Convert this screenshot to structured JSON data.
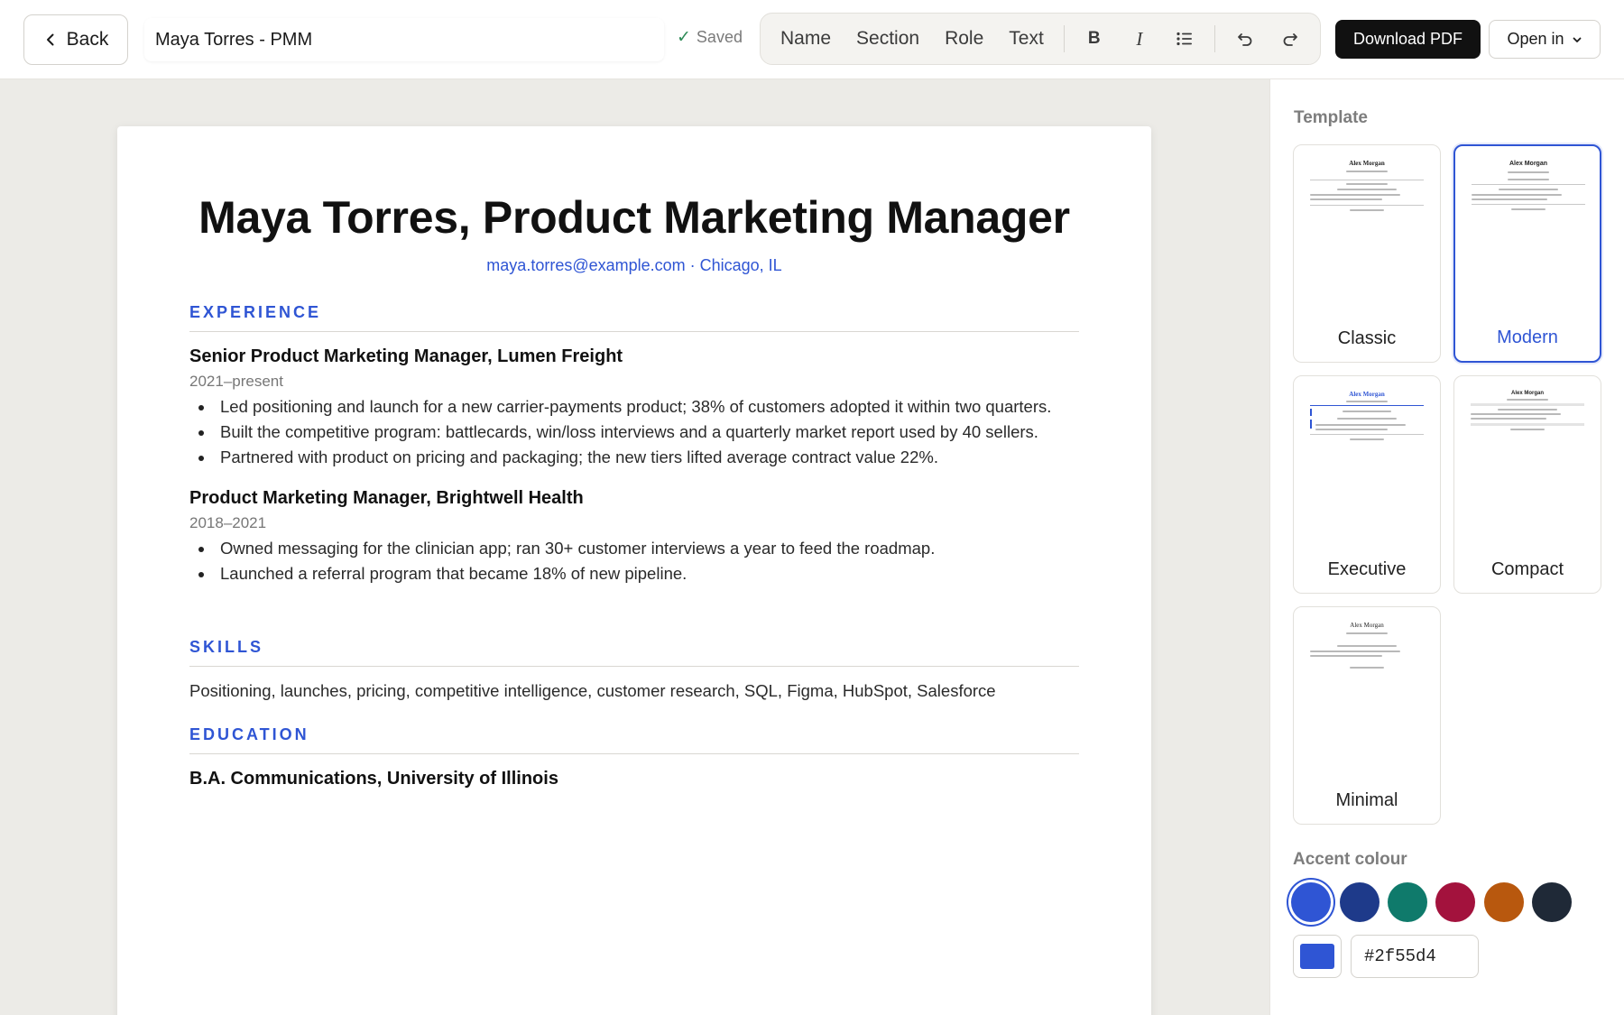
{
  "topbar": {
    "back_label": "Back",
    "document_name": "Maya Torres - PMM",
    "saved_label": "Saved",
    "toolbar": {
      "name_label": "Name",
      "section_label": "Section",
      "role_label": "Role",
      "text_label": "Text",
      "bold_label": "B",
      "italic_label": "I"
    },
    "download_label": "Download PDF",
    "open_in_label": "Open in"
  },
  "resume": {
    "name": "Maya Torres, Product Marketing Manager",
    "contact": "maya.torres@example.com · Chicago, IL",
    "experience": {
      "heading": "EXPERIENCE",
      "jobs": [
        {
          "title": "Senior Product Marketing Manager, Lumen Freight",
          "dates": "2021–present",
          "bullets": [
            "Led positioning and launch for a new carrier-payments product; 38% of customers adopted it within two quarters.",
            "Built the competitive program: battlecards, win/loss interviews and a quarterly market report used by 40 sellers.",
            "Partnered with product on pricing and packaging; the new tiers lifted average contract value 22%."
          ]
        },
        {
          "title": "Product Marketing Manager, Brightwell Health",
          "dates": "2018–2021",
          "bullets": [
            "Owned messaging for the clinician app; ran 30+ customer interviews a year to feed the roadmap.",
            "Launched a referral program that became 18% of new pipeline."
          ]
        }
      ]
    },
    "skills": {
      "heading": "SKILLS",
      "text": "Positioning, launches, pricing, competitive intelligence, customer research, SQL, Figma, HubSpot, Salesforce"
    },
    "education": {
      "heading": "EDUCATION",
      "text": "B.A. Communications, University of Illinois"
    }
  },
  "sidebar": {
    "template_label": "Template",
    "templates": [
      {
        "label": "Classic",
        "thumb_name": "Alex Morgan"
      },
      {
        "label": "Modern",
        "thumb_name": "Alex Morgan"
      },
      {
        "label": "Executive",
        "thumb_name": "Alex Morgan"
      },
      {
        "label": "Compact",
        "thumb_name": "Alex Morgan"
      },
      {
        "label": "Minimal",
        "thumb_name": "Alex Morgan"
      }
    ],
    "selected_template": "Modern",
    "accent_label": "Accent colour",
    "accent_colors": [
      "#2f55d4",
      "#1e3a8a",
      "#0f7a6b",
      "#a3123d",
      "#b8580e",
      "#1f2937"
    ],
    "accent_hex": "#2f55d4"
  },
  "colors": {
    "accent": "#2f55d4",
    "download_bg": "#111111"
  }
}
